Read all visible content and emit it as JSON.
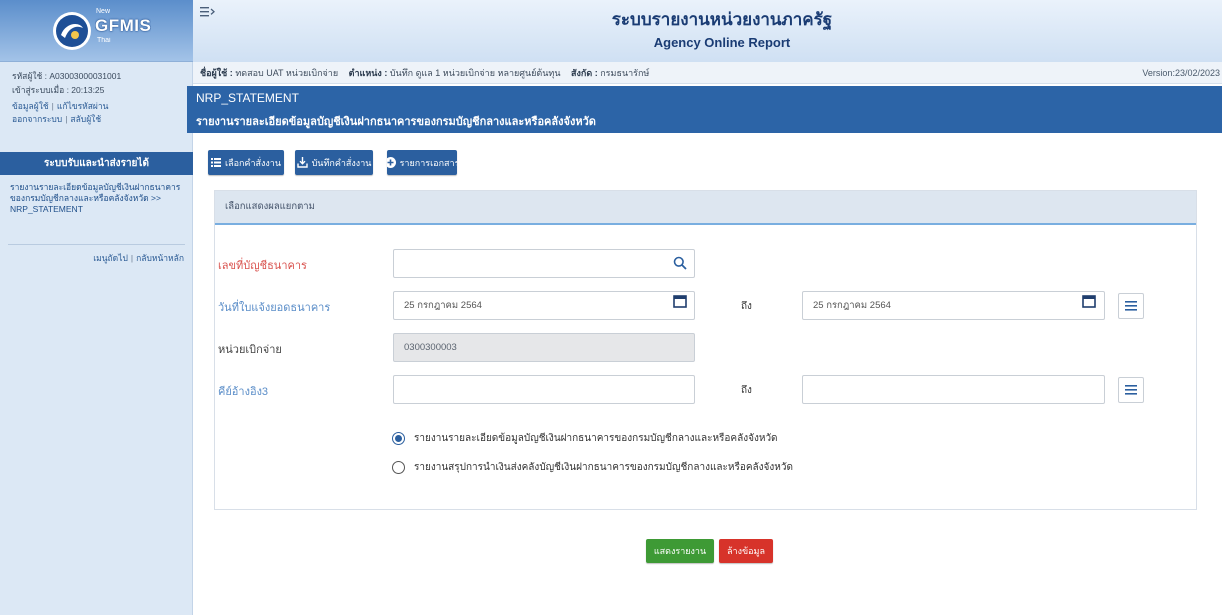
{
  "theme": {
    "sidebar_bg": "#dce8f5",
    "navy": "#2b5f9f",
    "title_bar": "#2c64a7",
    "show_button": "#3e9a35",
    "clear_button": "#d7332a",
    "required_label": "#d9534f",
    "field_label_blue": "#5a8dc8"
  },
  "logo": {
    "icon": "gfmis-emblem-icon",
    "tag": "New",
    "brand": "GFMIS",
    "sub": "Thai"
  },
  "header": {
    "menu_icon": "menu-toggle-icon",
    "title": "ระบบรายงานหน่วยงานภาครัฐ",
    "subtitle": "Agency Online Report"
  },
  "user_bar": {
    "name_label": "ชื่อผู้ใช้ :",
    "name": "ทดสอบ UAT หน่วยเบิกจ่าย",
    "position_label": "ตำแหน่ง :",
    "position": "บันทึก ดูแล 1 หน่วยเบิกจ่าย หลายศูนย์ต้นทุน",
    "affiliation_label": "สังกัด :",
    "affiliation": "กรมธนารักษ์",
    "version": "Version:23/02/2023"
  },
  "sidebar": {
    "user_id": "รหัสผู้ใช้ : A03003000031001",
    "login_time": "เข้าสู่ระบบเมื่อ : 20:13:25",
    "user_info_link": "ข้อมูลผู้ใช้",
    "change_password_link": "แก้ไขรหัสผ่าน",
    "logout_link": "ออกจากระบบ",
    "switch_user_link": "สลับผู้ใช้",
    "separator": "|",
    "section_title": "ระบบรับและนำส่งรายได้",
    "breadcrumb": "รายงานรายละเอียดข้อมูลบัญชีเงินฝากธนาคารของกรมบัญชีกลางและหรือคลังจังหวัด >> NRP_STATEMENT",
    "next_menu_link": "เมนูถัดไป",
    "home_link": "กลับหน้าหลัก"
  },
  "page": {
    "code": "NRP_STATEMENT",
    "title": "รายงานรายละเอียดข้อมูลบัญชีเงินฝากธนาคารของกรมบัญชีกลางและหรือคลังจังหวัด"
  },
  "toolbar": [
    {
      "label": "เลือกคำสั่งงาน",
      "icon": "list-icon"
    },
    {
      "label": "บันทึกคำสั่งงาน",
      "icon": "save-icon"
    },
    {
      "label": "รายการเอกสาร",
      "icon": "add-circle-icon"
    }
  ],
  "form": {
    "panel_title": "เลือกแสดงผลแยกตาม",
    "bank_account": {
      "label": "เลขที่บัญชีธนาคาร",
      "value": "",
      "icon": "search-icon"
    },
    "statement_date": {
      "label": "วันที่ใบแจ้งยอดธนาคาร",
      "from": "25 กรกฎาคม 2564",
      "to_label": "ถึง",
      "to": "25 กรกฎาคม 2564",
      "icon": "calendar-icon"
    },
    "disbursing_unit": {
      "label": "หน่วยเบิกจ่าย",
      "value": "0300300003"
    },
    "reference_key3": {
      "label": "คีย์อ้างอิง3",
      "from": "",
      "to_label": "ถึง",
      "to": ""
    },
    "report_options": [
      {
        "label": "รายงานรายละเอียดข้อมูลบัญชีเงินฝากธนาคารของกรมบัญชีกลางและหรือคลังจังหวัด",
        "selected": true
      },
      {
        "label": "รายงานสรุปการนำเงินส่งคลังบัญชีเงินฝากธนาคารของกรมบัญชีกลางและหรือคลังจังหวัด",
        "selected": false
      }
    ]
  },
  "actions": {
    "show_report": "แสดงรายงาน",
    "clear": "ล้างข้อมูล"
  }
}
